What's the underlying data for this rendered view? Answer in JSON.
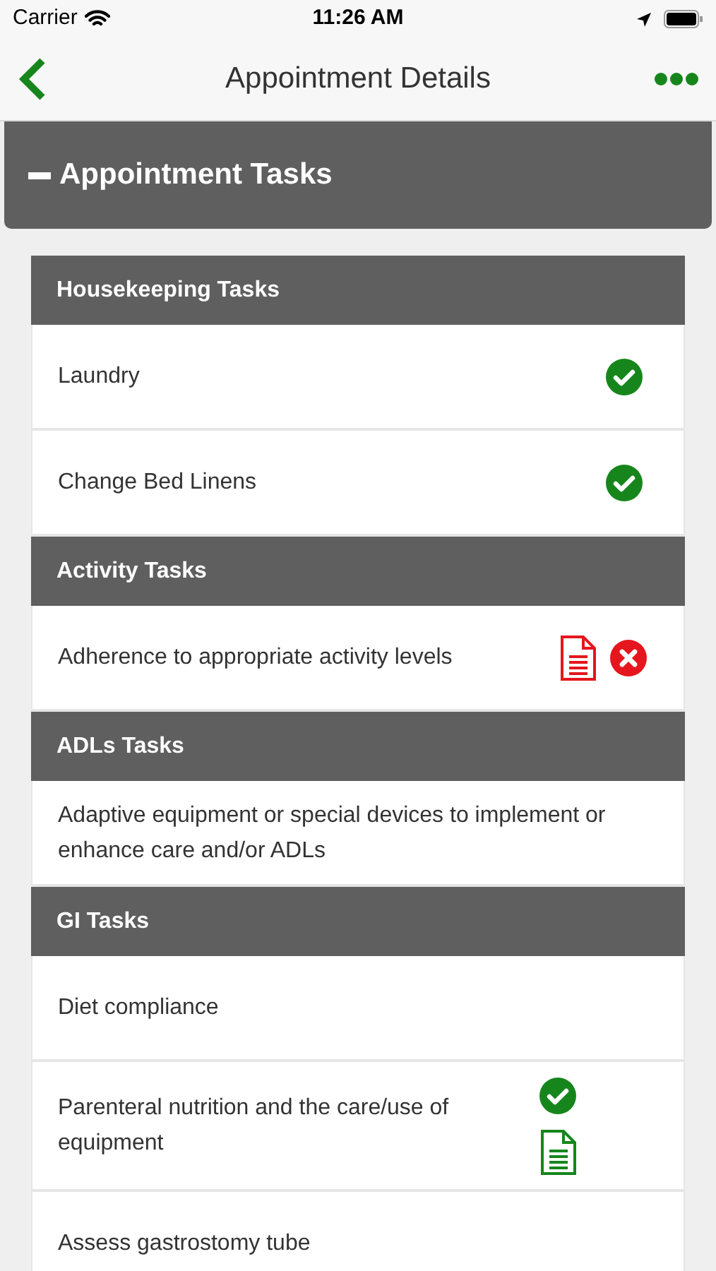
{
  "status_bar": {
    "carrier": "Carrier",
    "time": "11:26 AM"
  },
  "nav": {
    "title": "Appointment Details"
  },
  "panel": {
    "title": "Appointment Tasks",
    "expanded": true
  },
  "sections": [
    {
      "title": "Housekeeping Tasks",
      "tasks": [
        {
          "label": "Laundry",
          "kind": "done",
          "has_note": false
        },
        {
          "label": "Change Bed Linens",
          "kind": "done",
          "has_note": false
        }
      ]
    },
    {
      "title": "Activity Tasks",
      "tasks": [
        {
          "label": "Adherence to appropriate activity levels",
          "kind": "missed",
          "has_note": true
        }
      ]
    },
    {
      "title": "ADLs Tasks",
      "tasks": [
        {
          "label": "Adaptive equipment or special devices to implement or enhance care and/or ADLs",
          "kind": "open",
          "has_note": false
        }
      ]
    },
    {
      "title": "GI Tasks",
      "tasks": [
        {
          "label": "Diet compliance",
          "kind": "open",
          "has_note": false
        },
        {
          "label": "Parenteral nutrition and the care/use of equipment",
          "kind": "done",
          "has_note": true
        },
        {
          "label": "Assess gastrostomy tube",
          "kind": "open",
          "has_note": false
        }
      ]
    }
  ]
}
